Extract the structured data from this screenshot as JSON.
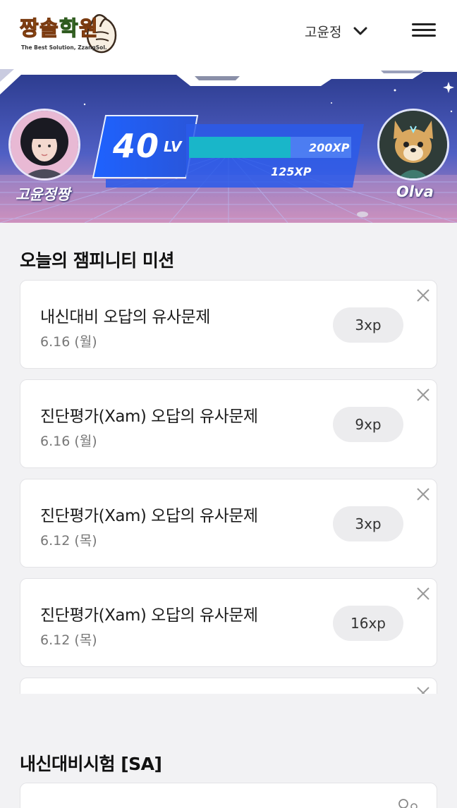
{
  "header": {
    "logo_text": "짱솔학원",
    "logo_tagline": "The Best Solution, ZzangSol.",
    "user_name": "고윤정",
    "icons": {
      "dropdown": "chevron-down-icon",
      "menu": "hamburger-menu-icon"
    }
  },
  "banner": {
    "player_name": "고윤정짱",
    "pet_name": "Olva",
    "level": "40",
    "level_unit": "LV",
    "xp_max": "200XP",
    "xp_current": "125XP",
    "xp_progress": 0.625,
    "colors": {
      "accent": "#1a5cf0",
      "xp_bar": "#19b6c9"
    }
  },
  "missions": {
    "title": "오늘의 잼피니티 미션",
    "items": [
      {
        "title": "내신대비 오답의 유사문제",
        "date": "6.16 (월)",
        "xp": "3xp"
      },
      {
        "title": "진단평가(Xam) 오답의 유사문제",
        "date": "6.16 (월)",
        "xp": "9xp"
      },
      {
        "title": "진단평가(Xam) 오답의 유사문제",
        "date": "6.12 (목)",
        "xp": "3xp"
      },
      {
        "title": "진단평가(Xam) 오답의 유사문제",
        "date": "6.12 (목)",
        "xp": "16xp"
      }
    ]
  },
  "exam_section": {
    "title": "내신대비시험 [SA]"
  }
}
